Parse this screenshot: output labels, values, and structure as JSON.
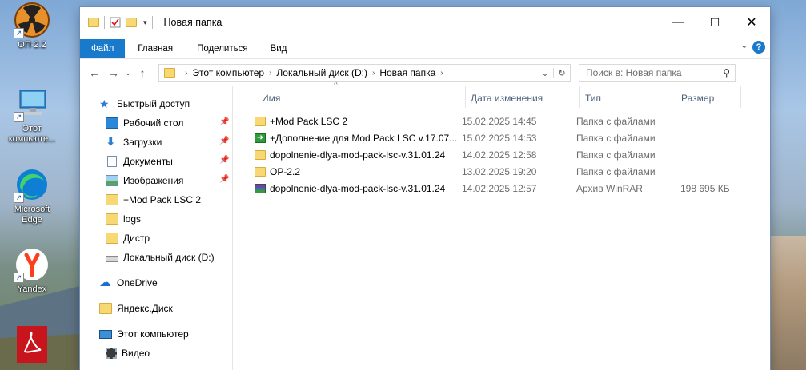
{
  "desktop": {
    "icons": [
      {
        "label": "ОП-2.2",
        "icon": "radiation-icon"
      },
      {
        "label": "Этот компьюте...",
        "icon": "computer-icon"
      },
      {
        "label": "Microsoft Edge",
        "icon": "edge-icon"
      },
      {
        "label": "Yandex",
        "icon": "yandex-icon"
      },
      {
        "label": "",
        "icon": "pdf-icon"
      }
    ]
  },
  "window": {
    "title": "Новая папка",
    "controls": {
      "minimize": "—",
      "maximize": "☐",
      "close": "✕"
    },
    "ribbon": {
      "tabs": [
        "Файл",
        "Главная",
        "Поделиться",
        "Вид"
      ],
      "help": "?"
    },
    "address": {
      "breadcrumbs": [
        "Этот компьютер",
        "Локальный диск (D:)",
        "Новая папка"
      ],
      "search_placeholder": "Поиск в: Новая папка"
    },
    "nav": {
      "items": [
        {
          "label": "Быстрый доступ",
          "icon": "star-icon",
          "pinned": false
        },
        {
          "label": "Рабочий стол",
          "icon": "desktop-icon",
          "pinned": true
        },
        {
          "label": "Загрузки",
          "icon": "download-icon",
          "pinned": true
        },
        {
          "label": "Документы",
          "icon": "documents-icon",
          "pinned": true
        },
        {
          "label": "Изображения",
          "icon": "pictures-icon",
          "pinned": true
        },
        {
          "label": "+Mod Pack LSC 2",
          "icon": "folder-icon",
          "pinned": false
        },
        {
          "label": "logs",
          "icon": "folder-icon",
          "pinned": false
        },
        {
          "label": "Дистр",
          "icon": "folder-icon",
          "pinned": false
        },
        {
          "label": "Локальный диск (D:)",
          "icon": "drive-icon",
          "pinned": false
        },
        {
          "label": "OneDrive",
          "icon": "onedrive-icon",
          "pinned": false
        },
        {
          "label": "Яндекс.Диск",
          "icon": "yandex-disk-icon",
          "pinned": false
        },
        {
          "label": "Этот компьютер",
          "icon": "computer-icon",
          "pinned": false
        },
        {
          "label": "Видео",
          "icon": "video-icon",
          "pinned": false
        }
      ]
    },
    "files": {
      "columns": [
        "Имя",
        "Дата изменения",
        "Тип",
        "Размер"
      ],
      "rows": [
        {
          "name": "+Mod Pack LSC 2",
          "date": "15.02.2025 14:45",
          "type": "Папка с файлами",
          "size": "",
          "icon": "folder-icon"
        },
        {
          "name": "+Дополнение для Mod Pack LSC v.17.07...",
          "date": "15.02.2025 14:53",
          "type": "Папка с файлами",
          "size": "",
          "icon": "shortcut-arrow-icon"
        },
        {
          "name": "dopolnenie-dlya-mod-pack-lsc-v.31.01.24",
          "date": "14.02.2025 12:58",
          "type": "Папка с файлами",
          "size": "",
          "icon": "folder-icon"
        },
        {
          "name": "OP-2.2",
          "date": "13.02.2025 19:20",
          "type": "Папка с файлами",
          "size": "",
          "icon": "folder-icon"
        },
        {
          "name": "dopolnenie-dlya-mod-pack-lsc-v.31.01.24",
          "date": "14.02.2025 12:57",
          "type": "Архив WinRAR",
          "size": "198 695 КБ",
          "icon": "winrar-icon"
        }
      ]
    },
    "accent": "#1979ca"
  }
}
